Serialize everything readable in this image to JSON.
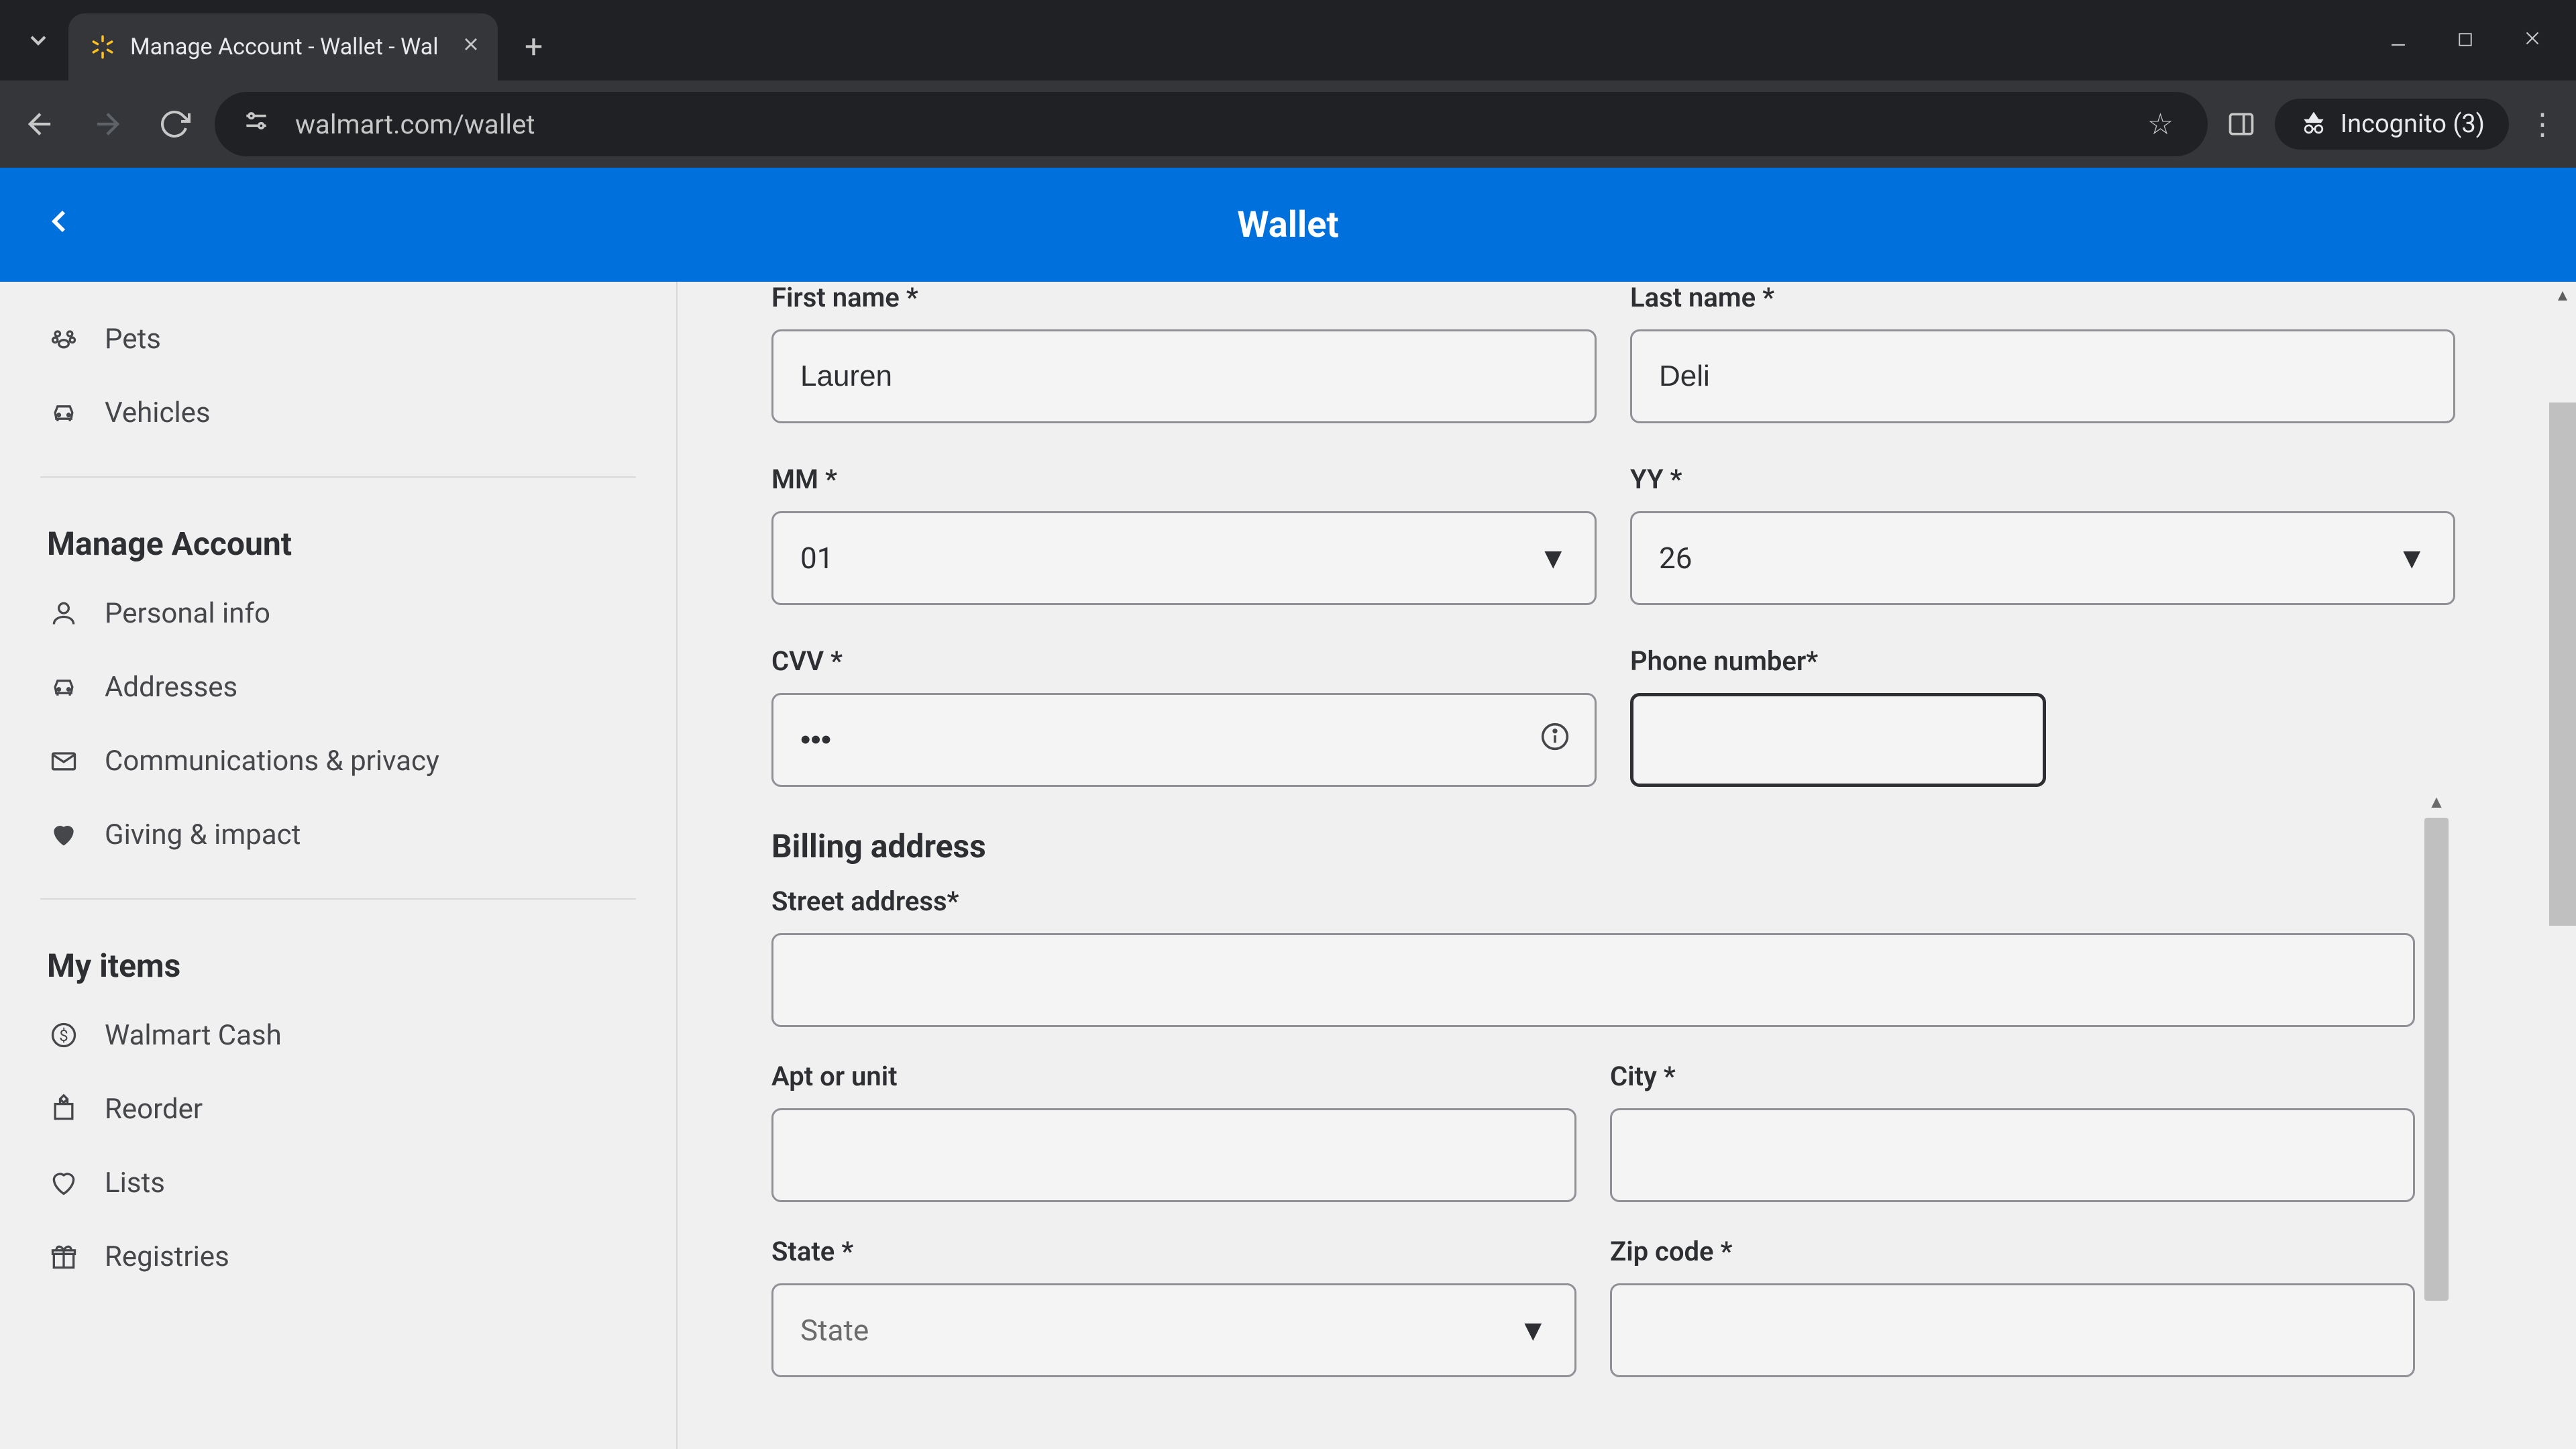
{
  "browser": {
    "tab_title": "Manage Account - Wallet - Wal",
    "url": "walmart.com/wallet",
    "incognito_label": "Incognito (3)"
  },
  "header": {
    "title": "Wallet"
  },
  "sidebar": {
    "top_items": [
      {
        "icon": "pets",
        "label": "Pets"
      },
      {
        "icon": "vehicles",
        "label": "Vehicles"
      }
    ],
    "section_manage": "Manage Account",
    "manage_items": [
      {
        "icon": "person",
        "label": "Personal info"
      },
      {
        "icon": "car",
        "label": "Addresses"
      },
      {
        "icon": "mail",
        "label": "Communications & privacy"
      },
      {
        "icon": "heart",
        "label": "Giving & impact"
      }
    ],
    "section_my_items": "My items",
    "my_items": [
      {
        "icon": "cash",
        "label": "Walmart Cash"
      },
      {
        "icon": "reorder",
        "label": "Reorder"
      },
      {
        "icon": "heart-outline",
        "label": "Lists"
      },
      {
        "icon": "gift",
        "label": "Registries"
      }
    ]
  },
  "form": {
    "first_name_label": "First name *",
    "first_name_value": "Lauren",
    "last_name_label": "Last name *",
    "last_name_value": "Deli",
    "mm_label": "MM *",
    "mm_value": "01",
    "yy_label": "YY *",
    "yy_value": "26",
    "cvv_label": "CVV *",
    "cvv_value": "•••",
    "phone_label": "Phone number*",
    "phone_value": "",
    "billing_title": "Billing address",
    "street_label": "Street address*",
    "street_value": "",
    "apt_label": "Apt or unit",
    "apt_value": "",
    "city_label": "City *",
    "city_value": "",
    "state_label": "State *",
    "state_placeholder": "State",
    "zip_label": "Zip code *",
    "zip_value": ""
  }
}
